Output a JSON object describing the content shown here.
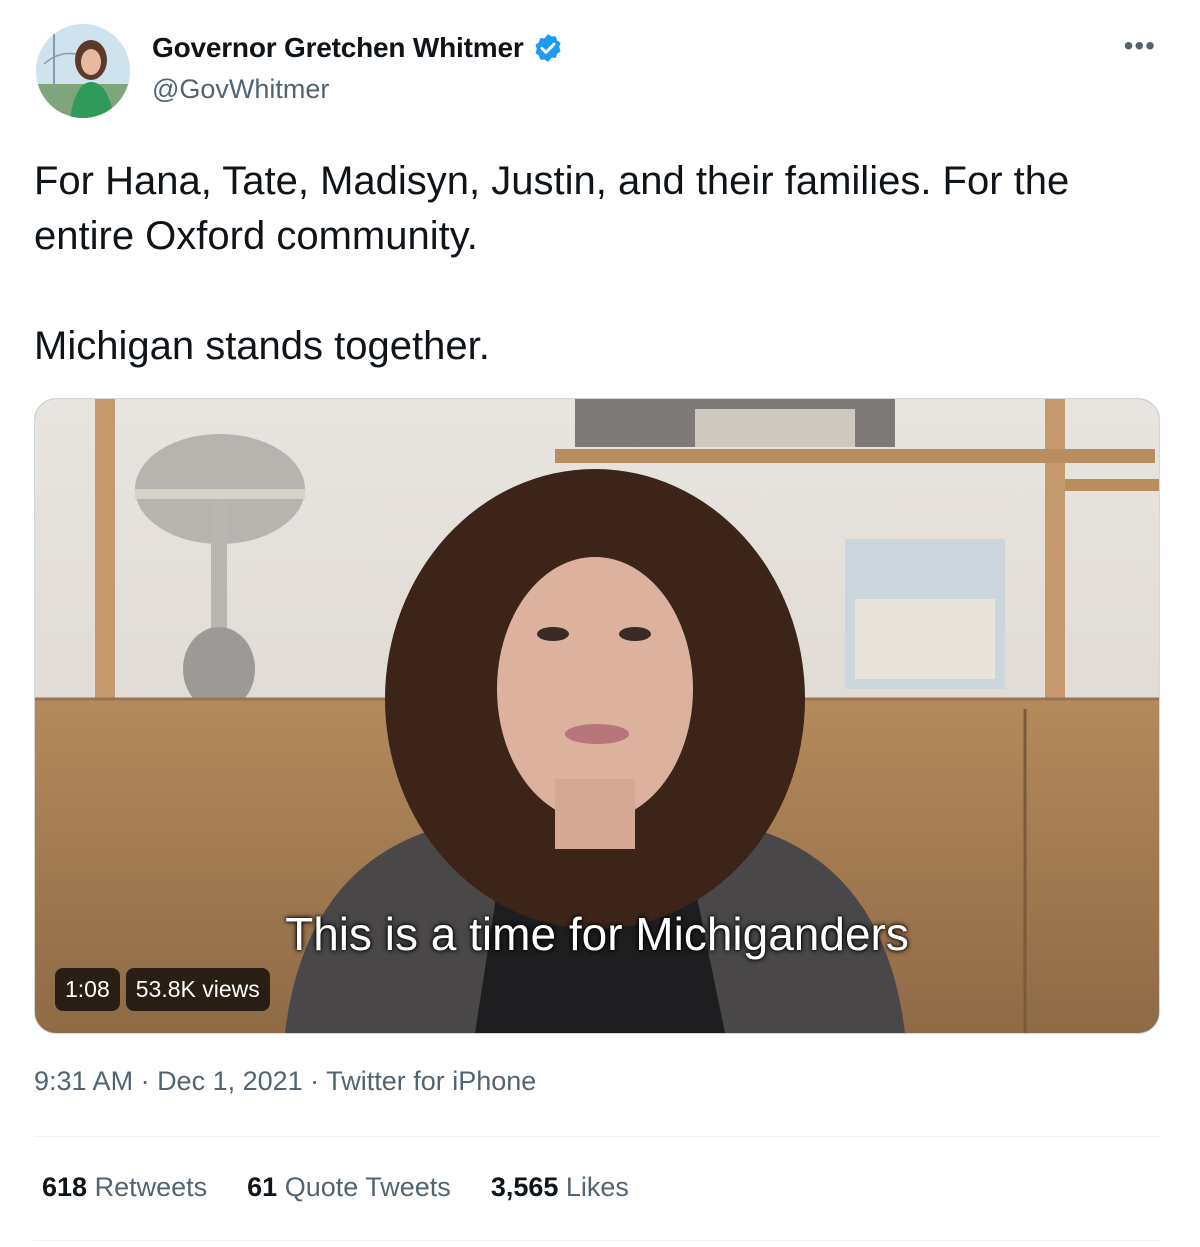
{
  "author": {
    "name": "Governor Gretchen Whitmer",
    "handle": "@GovWhitmer",
    "verified_color": "#1d9bf0"
  },
  "menu_icon": "more-horizontal-icon",
  "tweet": {
    "paragraphs": [
      "For Hana, Tate, Madisyn, Justin, and their families. For the entire Oxford community.",
      "Michigan stands together."
    ]
  },
  "media": {
    "caption": "This is a time for Michiganders",
    "duration": "1:08",
    "views": "53.8K views"
  },
  "meta": {
    "time": "9:31 AM",
    "separator": " · ",
    "date": "Dec 1, 2021",
    "source": "Twitter for iPhone"
  },
  "stats": {
    "retweets_count": "618",
    "retweets_label": "Retweets",
    "quotes_count": "61",
    "quotes_label": "Quote Tweets",
    "likes_count": "3,565",
    "likes_label": "Likes"
  }
}
